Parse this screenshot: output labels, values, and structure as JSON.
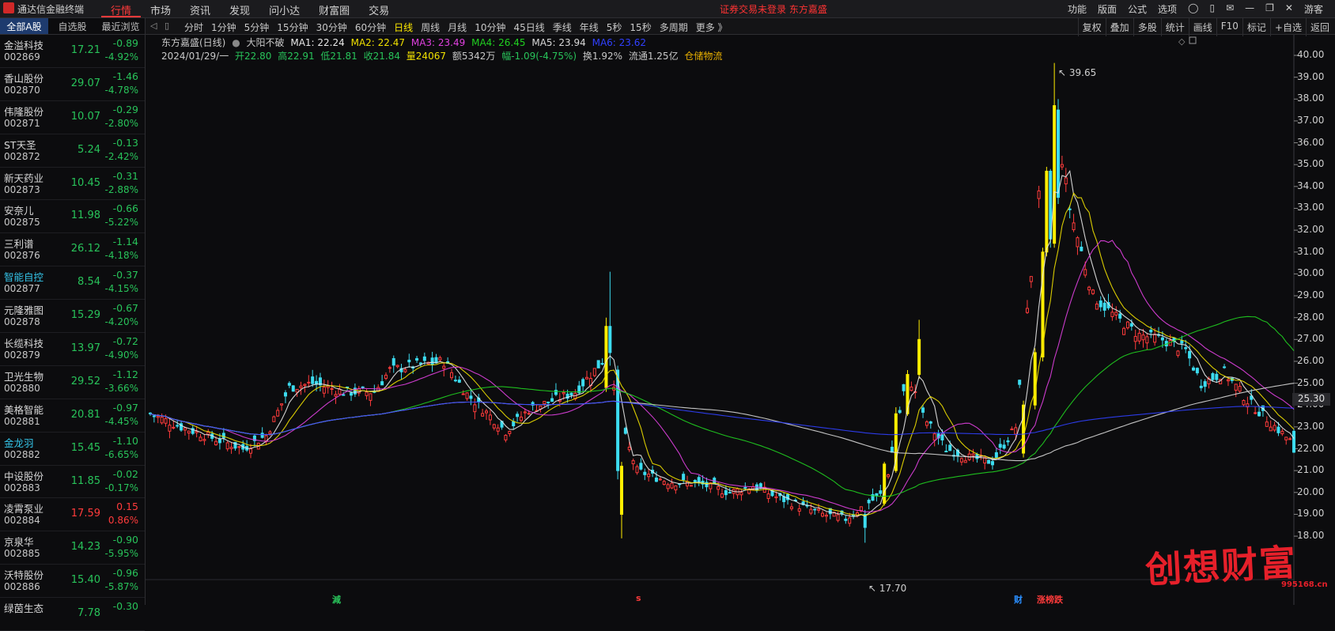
{
  "app_title": "通达信金融终端",
  "menu": [
    "行情",
    "市场",
    "资讯",
    "发现",
    "问小达",
    "财富圈",
    "交易"
  ],
  "notice": "证券交易未登录  东方嘉盛",
  "top_right": [
    "功能",
    "版面",
    "公式",
    "选项",
    "游客"
  ],
  "sidebar": {
    "tabs": [
      "全部A股",
      "自选股",
      "最近浏览"
    ],
    "stocks": [
      {
        "name": "金溢科技",
        "code": "002869",
        "price": "17.21",
        "change": "-0.89",
        "pct": "-4.92%",
        "dir": "down"
      },
      {
        "name": "香山股份",
        "code": "002870",
        "price": "29.07",
        "change": "-1.46",
        "pct": "-4.78%",
        "dir": "down"
      },
      {
        "name": "伟隆股份",
        "code": "002871",
        "price": "10.07",
        "change": "-0.29",
        "pct": "-2.80%",
        "dir": "down"
      },
      {
        "name": "ST天圣",
        "code": "002872",
        "price": "5.24",
        "change": "-0.13",
        "pct": "-2.42%",
        "dir": "down"
      },
      {
        "name": "新天药业",
        "code": "002873",
        "price": "10.45",
        "change": "-0.31",
        "pct": "-2.88%",
        "dir": "down"
      },
      {
        "name": "安奈儿",
        "code": "002875",
        "price": "11.98",
        "change": "-0.66",
        "pct": "-5.22%",
        "dir": "down"
      },
      {
        "name": "三利谱",
        "code": "002876",
        "price": "26.12",
        "change": "-1.14",
        "pct": "-4.18%",
        "dir": "down"
      },
      {
        "name": "智能自控",
        "code": "002877",
        "price": "8.54",
        "change": "-0.37",
        "pct": "-4.15%",
        "dir": "down",
        "highlight": true
      },
      {
        "name": "元隆雅图",
        "code": "002878",
        "price": "15.29",
        "change": "-0.67",
        "pct": "-4.20%",
        "dir": "down"
      },
      {
        "name": "长缆科技",
        "code": "002879",
        "price": "13.97",
        "change": "-0.72",
        "pct": "-4.90%",
        "dir": "down"
      },
      {
        "name": "卫光生物",
        "code": "002880",
        "price": "29.52",
        "change": "-1.12",
        "pct": "-3.66%",
        "dir": "down"
      },
      {
        "name": "美格智能",
        "code": "002881",
        "price": "20.81",
        "change": "-0.97",
        "pct": "-4.45%",
        "dir": "down"
      },
      {
        "name": "金龙羽",
        "code": "002882",
        "price": "15.45",
        "change": "-1.10",
        "pct": "-6.65%",
        "dir": "down",
        "highlight": true
      },
      {
        "name": "中设股份",
        "code": "002883",
        "price": "11.85",
        "change": "-0.02",
        "pct": "-0.17%",
        "dir": "down"
      },
      {
        "name": "凌霄泵业",
        "code": "002884",
        "price": "17.59",
        "change": "0.15",
        "pct": "0.86%",
        "dir": "up"
      },
      {
        "name": "京泉华",
        "code": "002885",
        "price": "14.23",
        "change": "-0.90",
        "pct": "-5.95%",
        "dir": "down"
      },
      {
        "name": "沃特股份",
        "code": "002886",
        "price": "15.40",
        "change": "-0.96",
        "pct": "-5.87%",
        "dir": "down"
      },
      {
        "name": "绿茵生态",
        "code": "",
        "price": "7.78",
        "change": "-0.30",
        "pct": "",
        "dir": "down"
      }
    ]
  },
  "periods": [
    "分时",
    "1分钟",
    "5分钟",
    "15分钟",
    "30分钟",
    "60分钟",
    "日线",
    "周线",
    "月线",
    "10分钟",
    "45日线",
    "季线",
    "年线",
    "5秒",
    "15秒",
    "多周期",
    "更多 》"
  ],
  "active_period": "日线",
  "chart_tools": [
    "复权",
    "叠加",
    "多股",
    "统计",
    "画线",
    "F10",
    "标记",
    "+自选",
    "返回"
  ],
  "chart_header": {
    "title": "东方嘉盛(日线)",
    "indicator": "大阳不破",
    "ma": [
      {
        "label": "MA1: 22.24",
        "color": "#e8e8e8"
      },
      {
        "label": "MA2: 22.47",
        "color": "#f0e000"
      },
      {
        "label": "MA3: 23.49",
        "color": "#e040e0"
      },
      {
        "label": "MA4: 26.45",
        "color": "#20d020"
      },
      {
        "label": "MA5: 23.94",
        "color": "#d8d8d8"
      },
      {
        "label": "MA6: 23.62",
        "color": "#3040ff"
      }
    ],
    "date": "2024/01/29/一",
    "open": "开22.80",
    "high": "高22.91",
    "low": "低21.81",
    "close": "收21.84",
    "volume": "量24067",
    "amount": "额5342万",
    "change": "幅-1.09(-4.75%)",
    "turnover": "换1.92%",
    "float": "流通1.25亿",
    "sector": "仓储物流"
  },
  "price_box": "25.30",
  "max_label": "39.65",
  "min_label": "17.70",
  "markers": [
    "減",
    "s",
    "财",
    "涨榜跌"
  ],
  "watermark": "创想财富",
  "watermark_url": "995168.cn",
  "chart_data": {
    "type": "candlestick",
    "title": "东方嘉盛(日线)",
    "y_ticks": [
      40,
      39,
      38,
      37,
      36,
      35,
      34,
      33,
      32,
      31,
      30,
      29,
      28,
      27,
      26,
      25,
      24,
      23,
      22,
      21,
      20,
      19,
      18
    ],
    "ylim": [
      17.5,
      40.2
    ],
    "last": {
      "date": "2024/01/29",
      "open": 22.8,
      "high": 22.91,
      "low": 21.81,
      "close": 21.84
    },
    "max_high": 39.65,
    "min_low": 17.7,
    "anchors": [
      {
        "i": 0,
        "c": 23.6
      },
      {
        "i": 8,
        "c": 23.0
      },
      {
        "i": 16,
        "c": 22.5
      },
      {
        "i": 24,
        "c": 22.0
      },
      {
        "i": 30,
        "c": 22.6
      },
      {
        "i": 36,
        "c": 24.8
      },
      {
        "i": 42,
        "c": 25.0
      },
      {
        "i": 50,
        "c": 24.6
      },
      {
        "i": 58,
        "c": 24.6
      },
      {
        "i": 62,
        "c": 25.6
      },
      {
        "i": 68,
        "c": 25.8
      },
      {
        "i": 76,
        "c": 26.0
      },
      {
        "i": 82,
        "c": 24.5
      },
      {
        "i": 88,
        "c": 23.5
      },
      {
        "i": 92,
        "c": 22.8
      },
      {
        "i": 98,
        "c": 23.8
      },
      {
        "i": 104,
        "c": 24.2
      },
      {
        "i": 110,
        "c": 24.6
      },
      {
        "i": 114,
        "c": 25.4
      },
      {
        "i": 118,
        "c": 26.2
      },
      {
        "i": 122,
        "c": 23.0
      },
      {
        "i": 126,
        "c": 21.0
      },
      {
        "i": 134,
        "c": 20.5
      },
      {
        "i": 142,
        "c": 20.4
      },
      {
        "i": 150,
        "c": 20.0
      },
      {
        "i": 156,
        "c": 20.3
      },
      {
        "i": 162,
        "c": 19.8
      },
      {
        "i": 168,
        "c": 19.4
      },
      {
        "i": 174,
        "c": 19.0
      },
      {
        "i": 180,
        "c": 18.8
      },
      {
        "i": 184,
        "c": 19.3
      },
      {
        "i": 190,
        "c": 20.0
      },
      {
        "i": 196,
        "c": 25.5
      },
      {
        "i": 200,
        "c": 23.5
      },
      {
        "i": 206,
        "c": 22.0
      },
      {
        "i": 212,
        "c": 21.6
      },
      {
        "i": 218,
        "c": 21.4
      },
      {
        "i": 224,
        "c": 23.0
      },
      {
        "i": 230,
        "c": 33.5
      },
      {
        "i": 234,
        "c": 37.5
      },
      {
        "i": 238,
        "c": 33.0
      },
      {
        "i": 244,
        "c": 29.0
      },
      {
        "i": 250,
        "c": 28.0
      },
      {
        "i": 256,
        "c": 27.2
      },
      {
        "i": 262,
        "c": 27.0
      },
      {
        "i": 268,
        "c": 26.5
      },
      {
        "i": 272,
        "c": 25.0
      },
      {
        "i": 278,
        "c": 25.5
      },
      {
        "i": 284,
        "c": 24.2
      },
      {
        "i": 290,
        "c": 23.2
      },
      {
        "i": 296,
        "c": 22.2
      }
    ],
    "ma_lines": [
      {
        "name": "MA1",
        "color": "#e8e8e8",
        "period": 5
      },
      {
        "name": "MA2",
        "color": "#f0e000",
        "period": 10
      },
      {
        "name": "MA3",
        "color": "#e040e0",
        "period": 20
      },
      {
        "name": "MA4",
        "color": "#20d020",
        "period": 60
      },
      {
        "name": "MA5",
        "color": "#d8d8d8",
        "period": 120
      },
      {
        "name": "MA6",
        "color": "#3040ff",
        "period": 250
      }
    ]
  }
}
